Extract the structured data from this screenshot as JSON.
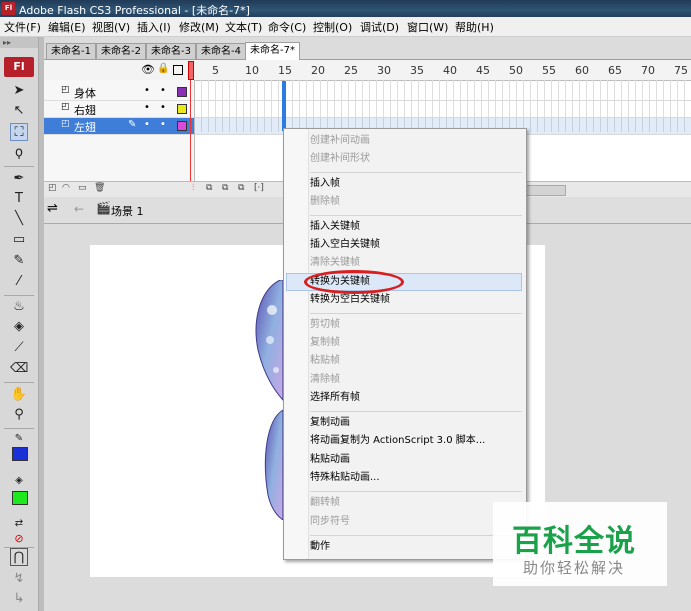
{
  "window": {
    "title": "Adobe Flash CS3 Professional - [未命名-7*]",
    "logo_text": "Fl"
  },
  "menu": {
    "items": [
      "文件(F)",
      "编辑(E)",
      "视图(V)",
      "插入(I)",
      "修改(M)",
      "文本(T)",
      "命令(C)",
      "控制(O)",
      "调试(D)",
      "窗口(W)",
      "帮助(H)"
    ]
  },
  "tabs": [
    "未命名-1",
    "未命名-2",
    "未命名-3",
    "未命名-4",
    "未命名-7*"
  ],
  "active_tab_index": 4,
  "timeline": {
    "frame_numbers": [
      "5",
      "10",
      "15",
      "20",
      "25",
      "30",
      "35",
      "40",
      "45",
      "50",
      "55",
      "60",
      "65",
      "70",
      "75"
    ],
    "layers": [
      {
        "name": "身体",
        "color": "#8b2fb8",
        "selected": false
      },
      {
        "name": "右翅",
        "color": "#e8e81a",
        "selected": false
      },
      {
        "name": "左翅",
        "color": "#d94ad9",
        "selected": true
      }
    ]
  },
  "scene": {
    "label": "场景 1"
  },
  "context_menu": {
    "items": [
      {
        "label": "创建补间动画",
        "disabled": true
      },
      {
        "label": "创建补间形状",
        "disabled": true
      },
      {
        "label": "插入帧",
        "disabled": false
      },
      {
        "label": "删除帧",
        "disabled": true
      },
      {
        "label": "插入关键帧",
        "disabled": false
      },
      {
        "label": "插入空白关键帧",
        "disabled": false
      },
      {
        "label": "清除关键帧",
        "disabled": true
      },
      {
        "label": "转换为关键帧",
        "disabled": false,
        "highlighted": true
      },
      {
        "label": "转换为空白关键帧",
        "disabled": false
      },
      {
        "label": "剪切帧",
        "disabled": true
      },
      {
        "label": "复制帧",
        "disabled": true
      },
      {
        "label": "粘贴帧",
        "disabled": true
      },
      {
        "label": "清除帧",
        "disabled": true
      },
      {
        "label": "选择所有帧",
        "disabled": false
      },
      {
        "label": "复制动画",
        "disabled": false
      },
      {
        "label": "将动画复制为 ActionScript 3.0 脚本...",
        "disabled": false
      },
      {
        "label": "粘贴动画",
        "disabled": false
      },
      {
        "label": "特殊粘贴动画...",
        "disabled": false
      },
      {
        "label": "翻转帧",
        "disabled": true
      },
      {
        "label": "同步符号",
        "disabled": true
      },
      {
        "label": "動作",
        "disabled": false
      }
    ]
  },
  "watermark": {
    "big": "百科全说",
    "small": "助你轻松解决"
  },
  "colors": {
    "stroke": "#1a2fd6",
    "fill": "#1ee81e"
  }
}
